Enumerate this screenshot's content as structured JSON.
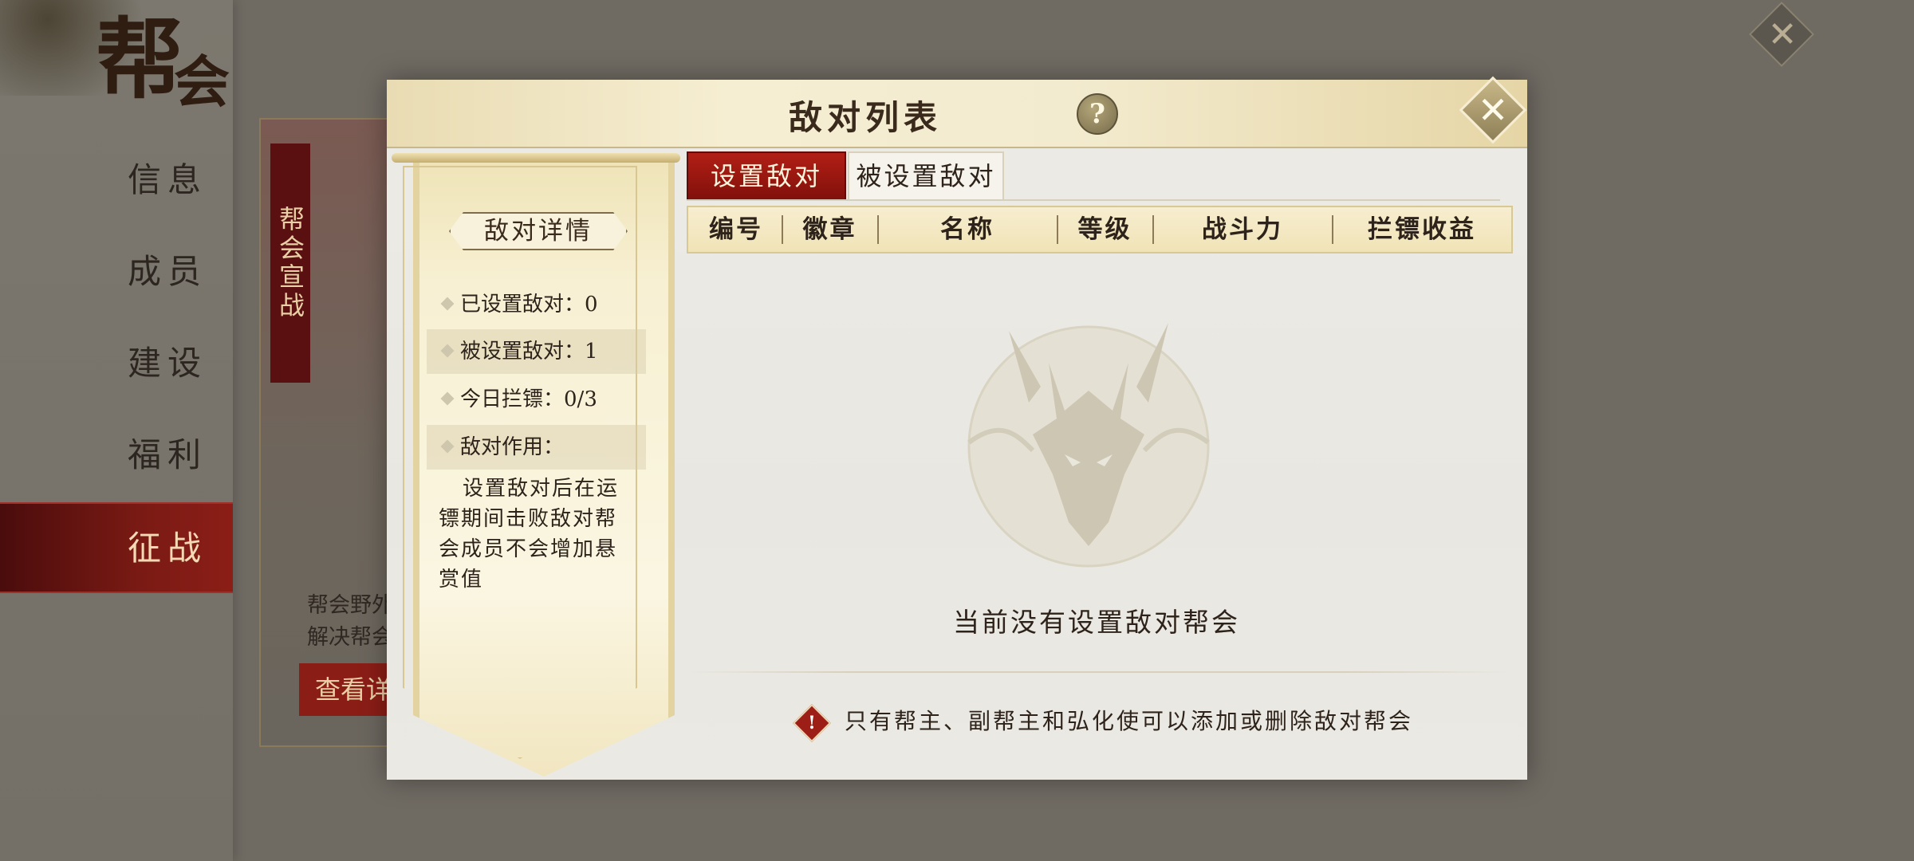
{
  "background": {
    "title_top": "帮",
    "title_bottom": "会",
    "nav": [
      "信息",
      "成员",
      "建设",
      "福利",
      "征战"
    ],
    "active_nav": "征战",
    "card_ribbon": "帮会宣战",
    "card_text_line1": "帮会野外",
    "card_text_line2": "解决帮会",
    "card_button": "查看详"
  },
  "modal": {
    "title": "敌对列表",
    "help_symbol": "?",
    "close_symbol": "✕",
    "detail": {
      "title": "敌对详情",
      "rows": [
        {
          "label": "已设置敌对：",
          "value": "0"
        },
        {
          "label": "被设置敌对：",
          "value": "1"
        },
        {
          "label": "今日拦镖：",
          "value": "0/3"
        },
        {
          "label": "敌对作用：",
          "value": ""
        }
      ],
      "effect": "设置敌对后在运镖期间击败敌对帮会成员不会增加悬赏值"
    },
    "tabs": [
      {
        "label": "设置敌对",
        "active": true
      },
      {
        "label": "被设置敌对",
        "active": false
      }
    ],
    "columns": [
      "编号",
      "徽章",
      "名称",
      "等级",
      "战斗力",
      "拦镖收益"
    ],
    "empty_message": "当前没有设置敌对帮会",
    "notice": "只有帮主、副帮主和弘化使可以添加或删除敌对帮会",
    "notice_icon": "!"
  },
  "colors": {
    "accent_red": "#9d1e17",
    "header_gold": "#f0e3b6",
    "text_dark": "#2e231a"
  }
}
